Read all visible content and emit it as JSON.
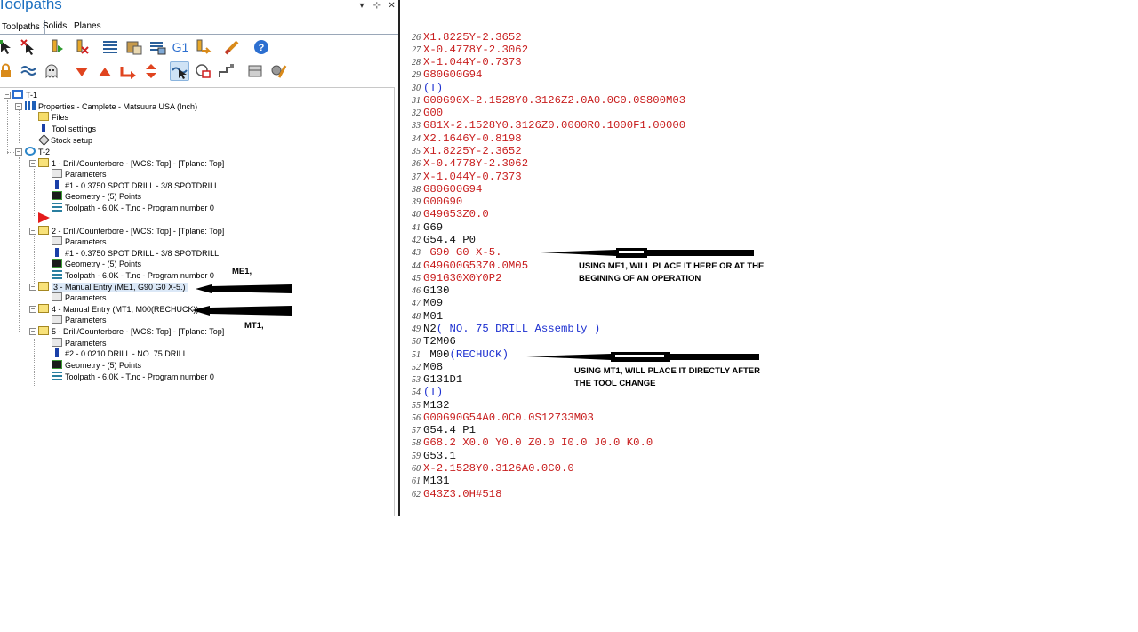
{
  "panel": {
    "title": "Toolpaths",
    "controls": [
      "▾",
      "⊹",
      "✕"
    ],
    "tabs": [
      {
        "label": "Toolpaths",
        "active": true
      },
      {
        "label": "Solids",
        "active": false
      },
      {
        "label": "Planes",
        "active": false
      }
    ],
    "toolbar_row1_icons": [
      "select-all-operations-icon",
      "select-invalid-operations-icon",
      "regenerate-selected-icon",
      "regenerate-dirty-icon",
      "backplot-icon",
      "simulate-icon",
      "verify-icon",
      "g1-post-icon",
      "post-selected-icon",
      "highfeed-icon",
      "help-icon"
    ],
    "toolbar_row1_g1_label": "G1",
    "toolbar_row2_icons": [
      "lock-icon",
      "toggle-display-icon",
      "ghost-icon",
      "move-down-icon",
      "move-up-icon",
      "insert-arrow-icon",
      "scroll-icon",
      "select-toolpath-icon",
      "hide-tools-icon",
      "insert-after-icon",
      "stock-model-icon",
      "options-icon"
    ]
  },
  "tree": {
    "machine_group_1": "T-1",
    "properties": "Properties - Camplete - Matsuura USA (Inch)",
    "files": "Files",
    "tool_settings": "Tool settings",
    "stock_setup": "Stock setup",
    "toolpath_group": "T-2",
    "op1": {
      "label": "1 - Drill/Counterbore - [WCS: Top] - [Tplane: Top]",
      "parameters": "Parameters",
      "tool": "#1 - 0.3750 SPOT DRILL -  3/8 SPOTDRILL",
      "geometry": "Geometry - (5) Points",
      "toolpath": "Toolpath - 6.0K - T.nc - Program number 0"
    },
    "op2": {
      "label": "2 - Drill/Counterbore - [WCS: Top] - [Tplane: Top]",
      "parameters": "Parameters",
      "tool": "#1 - 0.3750 SPOT DRILL -  3/8 SPOTDRILL",
      "geometry": "Geometry - (5) Points",
      "toolpath": "Toolpath - 6.0K - T.nc - Program number 0"
    },
    "op3": {
      "label": "3 - Manual Entry (ME1, G90 G0 X-5.)",
      "parameters": "Parameters"
    },
    "op4": {
      "label": "4 - Manual Entry (MT1, M00(RECHUCK))",
      "parameters": "Parameters"
    },
    "op5": {
      "label": "5 - Drill/Counterbore - [WCS: Top] - [Tplane: Top]",
      "parameters": "Parameters",
      "tool": "#2 - 0.0210 DRILL -  NO. 75 DRILL",
      "geometry": "Geometry - (5) Points",
      "toolpath": "Toolpath - 6.0K - T.nc - Program number 0"
    }
  },
  "annotations": {
    "me1_label": "ME1,",
    "mt1_label": "MT1,",
    "me1_note_line1": "USING ME1, WILL PLACE IT HERE OR AT THE",
    "me1_note_line2": "BEGINING OF AN OPERATION",
    "mt1_note_line1": "USING MT1, WILL PLACE IT DIRECTLY AFTER",
    "mt1_note_line2": "THE TOOL CHANGE"
  },
  "code_lines": [
    {
      "n": "26",
      "text": "X1.8225Y-2.3652",
      "color": "red"
    },
    {
      "n": "27",
      "text": "X-0.4778Y-2.3062",
      "color": "red"
    },
    {
      "n": "28",
      "text": "X-1.044Y-0.7373",
      "color": "red"
    },
    {
      "n": "29",
      "text": "G80G00G94",
      "color": "red"
    },
    {
      "n": "30",
      "text": "(T)",
      "color": "blue"
    },
    {
      "n": "31",
      "text": "G00G90X-2.1528Y0.3126Z2.0A0.0C0.0S800M03",
      "color": "red"
    },
    {
      "n": "32",
      "text": "G00",
      "color": "red"
    },
    {
      "n": "33",
      "text": "G81X-2.1528Y0.3126Z0.0000R0.1000F1.00000",
      "color": "red"
    },
    {
      "n": "34",
      "text": "X2.1646Y-0.8198",
      "color": "red"
    },
    {
      "n": "35",
      "text": "X1.8225Y-2.3652",
      "color": "red"
    },
    {
      "n": "36",
      "text": "X-0.4778Y-2.3062",
      "color": "red"
    },
    {
      "n": "37",
      "text": "X-1.044Y-0.7373",
      "color": "red"
    },
    {
      "n": "38",
      "text": "G80G00G94",
      "color": "red"
    },
    {
      "n": "39",
      "text": "G00G90",
      "color": "red"
    },
    {
      "n": "40",
      "text": "G49G53Z0.0",
      "color": "red"
    },
    {
      "n": "41",
      "text": "G69",
      "color": "black"
    },
    {
      "n": "42",
      "text": "G54.4 P0",
      "color": "black"
    },
    {
      "n": "43",
      "text": " G90 G0 X-5.",
      "color": "red"
    },
    {
      "n": "44",
      "text": "G49G00G53Z0.0M05",
      "color": "red"
    },
    {
      "n": "45",
      "text": "G91G30X0Y0P2",
      "color": "red"
    },
    {
      "n": "46",
      "text": "G130",
      "color": "black"
    },
    {
      "n": "47",
      "text": "M09",
      "color": "black"
    },
    {
      "n": "48",
      "text": "M01",
      "color": "black"
    },
    {
      "n": "49",
      "text": "N2( NO. 75 DRILL Assembly )",
      "color": "mixed",
      "prefix": "N2",
      "rest": "( NO. 75 DRILL Assembly )"
    },
    {
      "n": "50",
      "text": "T2M06",
      "color": "black"
    },
    {
      "n": "51",
      "text": " M00(RECHUCK)",
      "color": "mixed",
      "prefix": " M00",
      "rest": "(RECHUCK)"
    },
    {
      "n": "52",
      "text": "M08",
      "color": "black"
    },
    {
      "n": "53",
      "text": "G131D1",
      "color": "black"
    },
    {
      "n": "54",
      "text": "(T)",
      "color": "blue"
    },
    {
      "n": "55",
      "text": "M132",
      "color": "black"
    },
    {
      "n": "56",
      "text": "G00G90G54A0.0C0.0S12733M03",
      "color": "red"
    },
    {
      "n": "57",
      "text": "G54.4 P1",
      "color": "black"
    },
    {
      "n": "58",
      "text": "G68.2 X0.0 Y0.0 Z0.0 I0.0 J0.0 K0.0",
      "color": "red"
    },
    {
      "n": "59",
      "text": "G53.1",
      "color": "black"
    },
    {
      "n": "60",
      "text": "X-2.1528Y0.3126A0.0C0.0",
      "color": "red"
    },
    {
      "n": "61",
      "text": "M131",
      "color": "black"
    },
    {
      "n": "62",
      "text": "G43Z3.0H#518",
      "color": "red"
    }
  ],
  "colors": {
    "code_red": "#c81e1e",
    "code_blue": "#1c2fd0",
    "code_black": "#111111",
    "accent": "#1a6fc0"
  }
}
